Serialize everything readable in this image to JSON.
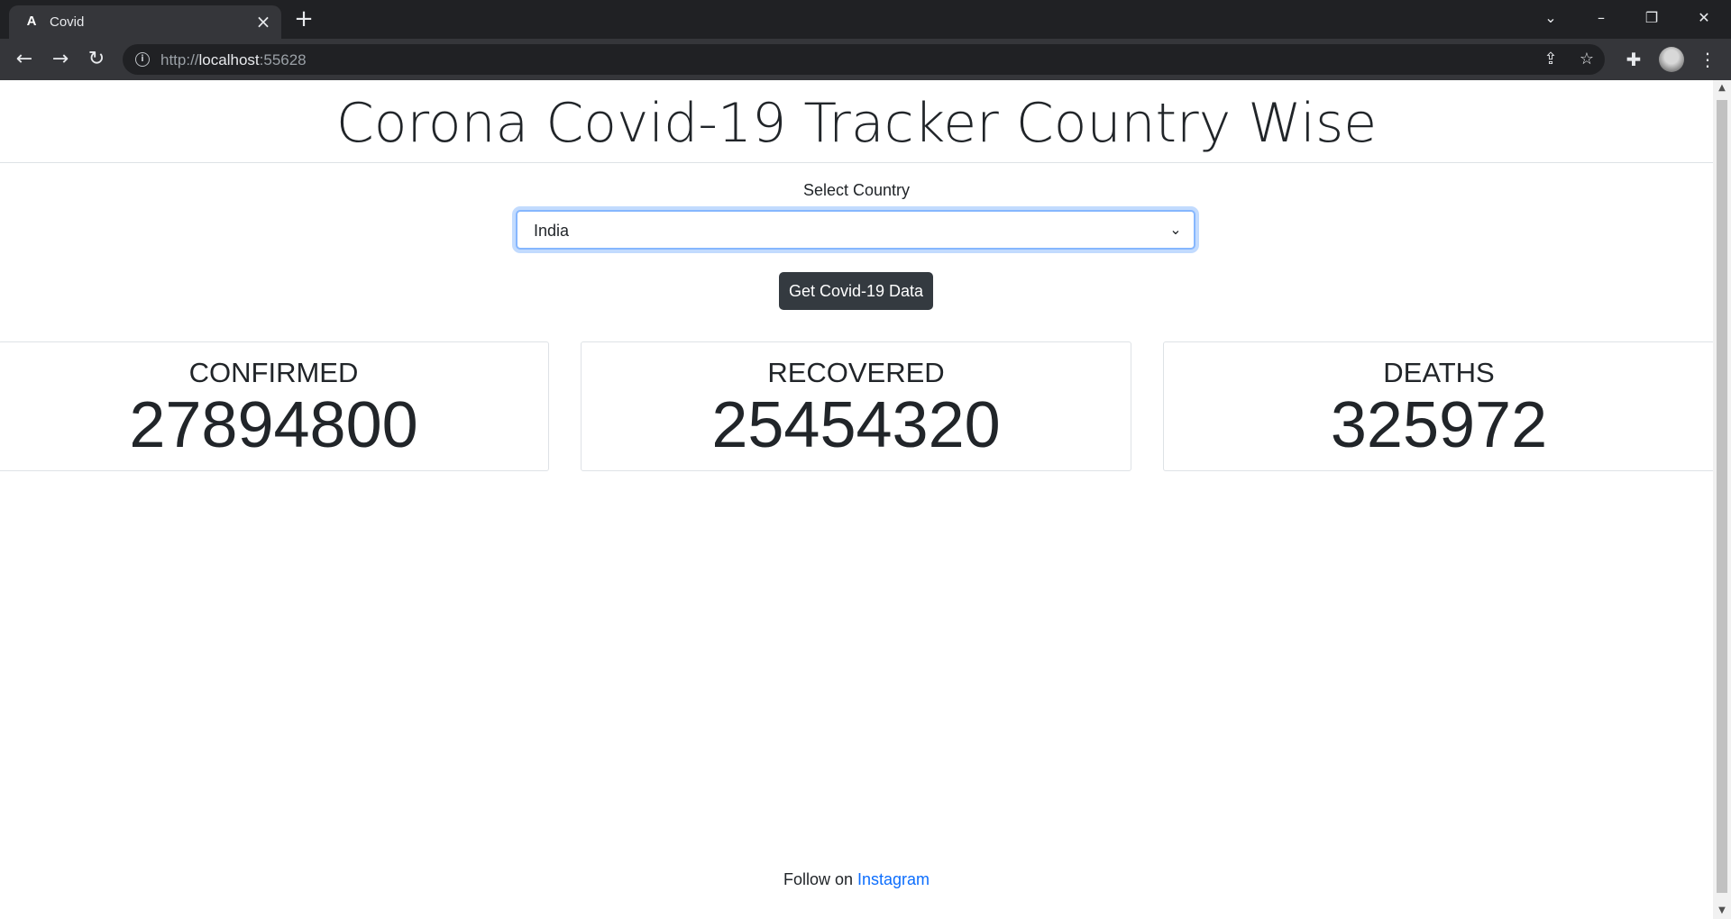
{
  "browser": {
    "tab_title": "Covid",
    "tab_favicon": "A",
    "url_prefix": "http://",
    "url_host": "localhost",
    "url_port": ":55628"
  },
  "page": {
    "title": "Corona Covid-19 Tracker Country Wise",
    "select_label": "Select Country",
    "selected_country": "India",
    "button_label": "Get Covid-19 Data",
    "cards": [
      {
        "label": "CONFIRMED",
        "value": "27894800"
      },
      {
        "label": "RECOVERED",
        "value": "25454320"
      },
      {
        "label": "DEATHS",
        "value": "325972"
      }
    ],
    "footer_text": "Follow on ",
    "footer_link": "Instagram"
  },
  "colors": {
    "chrome_dark": "#202124",
    "chrome_toolbar": "#35363a",
    "button_dark": "#343a40",
    "link_blue": "#0d6efd",
    "focus_border": "#86b7fe"
  },
  "icons": {
    "back": "arrow-left-icon",
    "forward": "arrow-right-icon",
    "reload": "reload-icon",
    "info": "info-icon",
    "share": "share-icon",
    "bookmark": "star-icon",
    "extensions": "puzzle-icon",
    "menu": "kebab-menu-icon"
  }
}
